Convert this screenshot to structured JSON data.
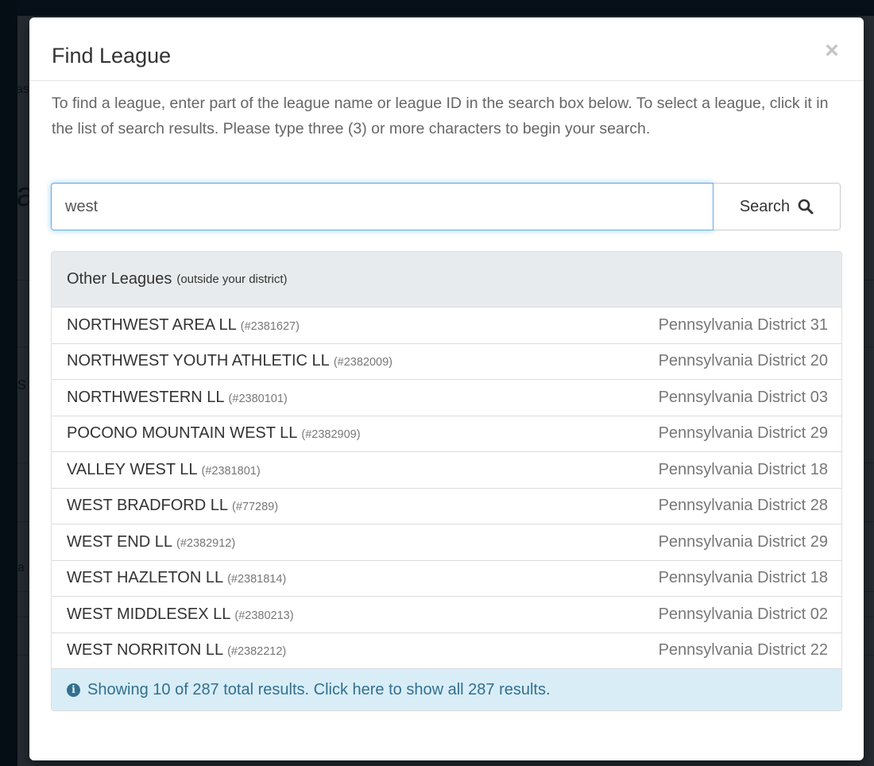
{
  "modal": {
    "title": "Find League",
    "close_glyph": "×",
    "intro": "To find a league, enter part of the league name or league ID in the search box below. To select a league, click it in the list of search results. Please type three (3) or more characters to begin your search."
  },
  "search": {
    "value": "west",
    "button_label": "Search",
    "button_icon": "search-icon"
  },
  "results": {
    "heading": "Other Leagues",
    "heading_sub": "(outside your district)",
    "rows": [
      {
        "name": "NORTHWEST AREA LL",
        "id": "(#2381627)",
        "district": "Pennsylvania District 31"
      },
      {
        "name": "NORTHWEST YOUTH ATHLETIC LL",
        "id": "(#2382009)",
        "district": "Pennsylvania District 20"
      },
      {
        "name": "NORTHWESTERN LL",
        "id": "(#2380101)",
        "district": "Pennsylvania District 03"
      },
      {
        "name": "POCONO MOUNTAIN WEST LL",
        "id": "(#2382909)",
        "district": "Pennsylvania District 29"
      },
      {
        "name": "VALLEY WEST LL",
        "id": "(#2381801)",
        "district": "Pennsylvania District 18"
      },
      {
        "name": "WEST BRADFORD LL",
        "id": "(#77289)",
        "district": "Pennsylvania District 28"
      },
      {
        "name": "WEST END LL",
        "id": "(#2382912)",
        "district": "Pennsylvania District 29"
      },
      {
        "name": "WEST HAZLETON LL",
        "id": "(#2381814)",
        "district": "Pennsylvania District 18"
      },
      {
        "name": "WEST MIDDLESEX LL",
        "id": "(#2380213)",
        "district": "Pennsylvania District 02"
      },
      {
        "name": "WEST NORRITON LL",
        "id": "(#2382212)",
        "district": "Pennsylvania District 22"
      }
    ],
    "footer_icon": "info-icon",
    "footer_text": "Showing 10 of 287 total results. Click here to show all 287 results."
  },
  "background": {
    "fragments": [
      "as",
      "a",
      "s",
      "a"
    ]
  },
  "colors": {
    "accent": "#66afe9",
    "info_bg": "#d9edf7",
    "info_text": "#31708f",
    "heading_bg": "#e8ebed"
  }
}
